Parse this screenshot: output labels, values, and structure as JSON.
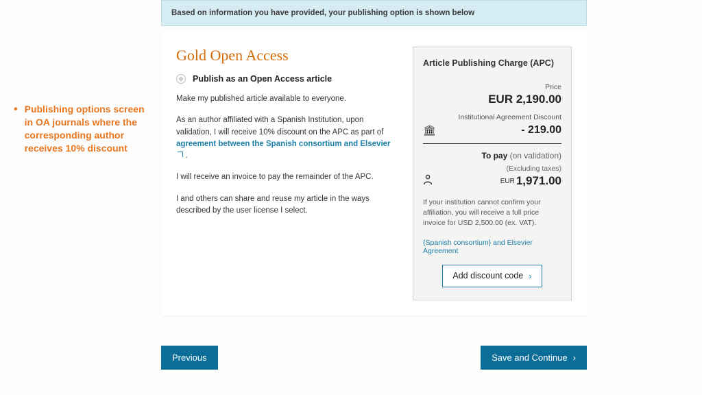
{
  "annotation": {
    "bullet": "•",
    "text": "Publishing options screen in OA journals where the corresponding author receives 10% discount"
  },
  "banner": "Based on information you have provided, your publishing option is shown below",
  "gold": {
    "title": "Gold Open Access",
    "option_label": "Publish as an Open Access article",
    "p1": "Make my published article available to everyone.",
    "p2_pre": "As an author affiliated with a Spanish Institution, upon validation, I will receive 10% discount on the APC as part of ",
    "p2_link": "agreement between the Spanish consortium and Elsevier",
    "p2_post": " .",
    "p3": "I will receive an invoice to pay the remainder of the APC.",
    "p4": "I and others can share and reuse my article in the ways described by the user license I select."
  },
  "apc": {
    "title": "Article Publishing Charge (APC)",
    "price_label": "Price",
    "price_value": "EUR 2,190.00",
    "discount_label": "Institutional Agreement Discount",
    "discount_value": "- 219.00",
    "to_pay_bold": "To pay",
    "to_pay_muted": " (on validation)",
    "excl": "(Excluding taxes)",
    "final_currency": "EUR",
    "final_value": "1,971.00",
    "note": "If your institution cannot confirm your affiliation, you will receive a full price invoice for USD 2,500.00 (ex. VAT).",
    "agreement_link": "{Spanish consortium} and Elsevier Agreement",
    "discount_btn": "Add discount code"
  },
  "nav": {
    "previous": "Previous",
    "save": "Save and Continue"
  }
}
